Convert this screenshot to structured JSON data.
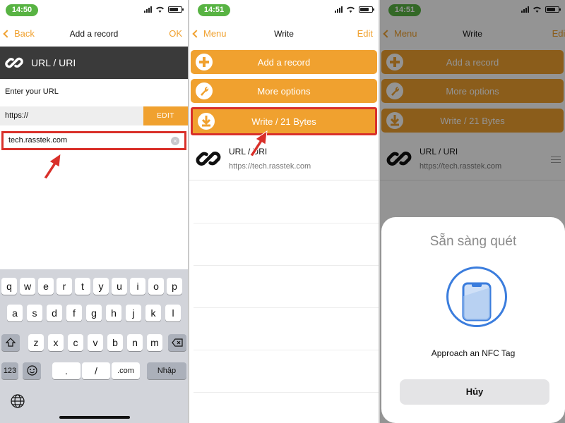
{
  "panels": [
    {
      "time": "14:50",
      "nav": {
        "back": "Back",
        "title": "Add a record",
        "right": "OK"
      },
      "header": "URL / URI",
      "enter_label": "Enter your URL",
      "prefix": "https://",
      "edit_label": "EDIT",
      "url_value": "tech.rasstek.com",
      "keyboard": {
        "row1": [
          "q",
          "w",
          "e",
          "r",
          "t",
          "y",
          "u",
          "i",
          "o",
          "p"
        ],
        "row2": [
          "a",
          "s",
          "d",
          "f",
          "g",
          "h",
          "j",
          "k",
          "l"
        ],
        "row3": [
          "z",
          "x",
          "c",
          "v",
          "b",
          "n",
          "m"
        ],
        "row4_123": "123",
        "row4_dot": ".",
        "row4_slash": "/",
        "row4_com": ".com",
        "row4_enter": "Nhập"
      }
    },
    {
      "time": "14:51",
      "nav": {
        "back": "Menu",
        "title": "Write",
        "right": "Edit"
      },
      "buttons": [
        "Add a record",
        "More options",
        "Write / 21 Bytes"
      ],
      "record": {
        "type": "URL / URI",
        "value": "https://tech.rasstek.com"
      }
    },
    {
      "time": "14:51",
      "nav": {
        "back": "Menu",
        "title": "Write",
        "right": "Edit"
      },
      "buttons": [
        "Add a record",
        "More options",
        "Write / 21 Bytes"
      ],
      "record": {
        "type": "URL / URI",
        "value": "https://tech.rasstek.com"
      },
      "sheet": {
        "title": "Sẵn sàng quét",
        "message": "Approach an NFC Tag",
        "cancel": "Hủy"
      }
    }
  ],
  "colors": {
    "accent": "#f0a12f",
    "highlight": "#d9302a",
    "nfc_blue": "#3b7ddd",
    "status_green": "#58b343"
  },
  "icons": [
    "link-icon",
    "plus-circle-icon",
    "wrench-icon",
    "download-arrow-icon",
    "phone-icon",
    "globe-icon",
    "shift-icon",
    "backspace-icon",
    "emoji-icon"
  ]
}
